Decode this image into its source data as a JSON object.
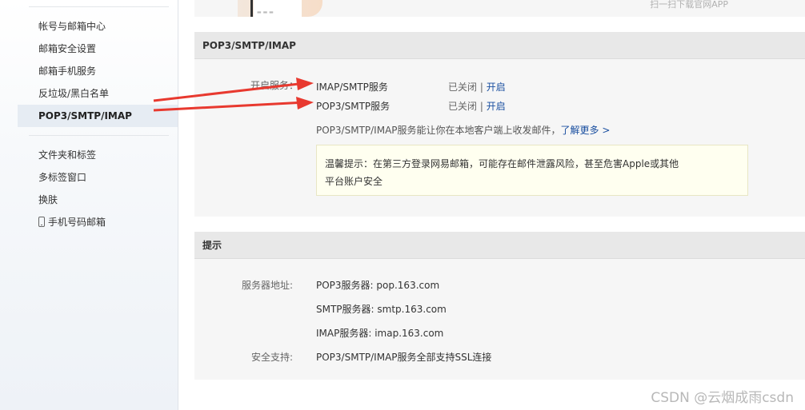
{
  "sidebar": {
    "items": [
      {
        "label": "帐号与邮箱中心"
      },
      {
        "label": "邮箱安全设置"
      },
      {
        "label": "邮箱手机服务"
      },
      {
        "label": "反垃圾/黑白名单"
      },
      {
        "label": "POP3/SMTP/IMAP"
      },
      {
        "label": "文件夹和标签"
      },
      {
        "label": "多标签窗口"
      },
      {
        "label": "换肤"
      },
      {
        "label": "手机号码邮箱",
        "icon": "mobile-phone-icon"
      }
    ],
    "active": "POP3/SMTP/IMAP"
  },
  "top_banner": {
    "download_text": "扫一扫下载官网APP"
  },
  "pop_panel": {
    "title": "POP3/SMTP/IMAP",
    "service_label": "开启服务：",
    "services": [
      {
        "name": "IMAP/SMTP服务",
        "status": "已关闭",
        "separator": "|",
        "action": "开启"
      },
      {
        "name": "POP3/SMTP服务",
        "status": "已关闭",
        "separator": "|",
        "action": "开启"
      }
    ],
    "description": "POP3/SMTP/IMAP服务能让你在本地客户端上收发邮件，",
    "learn_more": "了解更多 >",
    "tip_line1": "温馨提示：在第三方登录网易邮箱，可能存在邮件泄露风险，甚至危害Apple或其他",
    "tip_line2": "平台账户安全"
  },
  "tips_panel": {
    "title": "提示",
    "server_label": "服务器地址:",
    "servers": [
      "POP3服务器: pop.163.com",
      "SMTP服务器: smtp.163.com",
      "IMAP服务器: imap.163.com"
    ],
    "security_label": "安全支持:",
    "security_text": "POP3/SMTP/IMAP服务全部支持SSL连接"
  },
  "annotation": {
    "arrow_color": "#e8392f"
  },
  "watermark": "CSDN @云烟成雨csdn"
}
